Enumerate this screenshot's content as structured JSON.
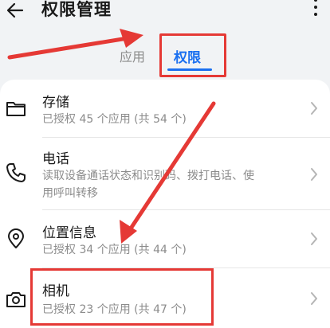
{
  "header": {
    "title": "权限管理",
    "back_icon": "arrow-left-icon",
    "more_icon": "more-vertical-icon"
  },
  "tabs": [
    {
      "label": "应用",
      "selected": false
    },
    {
      "label": "权限",
      "selected": true
    }
  ],
  "permissions": [
    {
      "title": "存储",
      "subtitle": "已授权 45 个应用 (共 54 个)",
      "icon": "folder-icon"
    },
    {
      "title": "电话",
      "subtitle_lines": [
        "读取设备通话状态和识别码、拨打电话、使",
        "用呼叫转移"
      ],
      "icon": "phone-icon"
    },
    {
      "title": "位置信息",
      "subtitle": "已授权 34 个应用 (共 44 个)",
      "icon": "location-pin-icon"
    },
    {
      "title": "相机",
      "subtitle": "已授权 23 个应用 (共 47 个)",
      "icon": "camera-icon"
    }
  ],
  "colors": {
    "accent": "#1a6ff0",
    "annotation": "#e53935",
    "background": "#f1f3f5",
    "card": "#ffffff"
  }
}
